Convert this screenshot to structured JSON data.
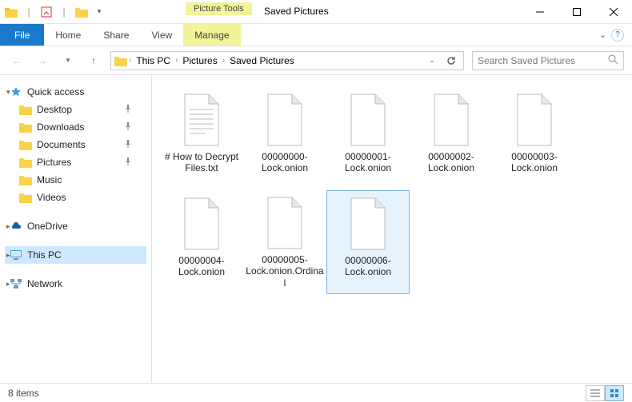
{
  "window": {
    "title": "Saved Pictures",
    "contextual_tab_label": "Picture Tools"
  },
  "ribbon": {
    "file": "File",
    "tabs": [
      "Home",
      "Share",
      "View"
    ],
    "contextual": "Manage"
  },
  "address": {
    "segments": [
      "This PC",
      "Pictures",
      "Saved Pictures"
    ]
  },
  "search": {
    "placeholder": "Search Saved Pictures"
  },
  "sidebar": {
    "quick_access": {
      "label": "Quick access",
      "items": [
        {
          "label": "Desktop",
          "pinned": true
        },
        {
          "label": "Downloads",
          "pinned": true
        },
        {
          "label": "Documents",
          "pinned": true
        },
        {
          "label": "Pictures",
          "pinned": true
        },
        {
          "label": "Music",
          "pinned": false
        },
        {
          "label": "Videos",
          "pinned": false
        }
      ]
    },
    "onedrive": {
      "label": "OneDrive"
    },
    "this_pc": {
      "label": "This PC"
    },
    "network": {
      "label": "Network"
    }
  },
  "files": [
    {
      "name": "# How to Decrypt Files.txt",
      "type": "txt",
      "selected": false
    },
    {
      "name": "00000000-Lock.onion",
      "type": "file",
      "selected": false
    },
    {
      "name": "00000001-Lock.onion",
      "type": "file",
      "selected": false
    },
    {
      "name": "00000002-Lock.onion",
      "type": "file",
      "selected": false
    },
    {
      "name": "00000003-Lock.onion",
      "type": "file",
      "selected": false
    },
    {
      "name": "00000004-Lock.onion",
      "type": "file",
      "selected": false
    },
    {
      "name": "00000005-Lock.onion.Ordinal",
      "type": "file",
      "selected": false
    },
    {
      "name": "00000006-Lock.onion",
      "type": "file",
      "selected": true
    }
  ],
  "status": {
    "item_count_label": "8 items"
  }
}
